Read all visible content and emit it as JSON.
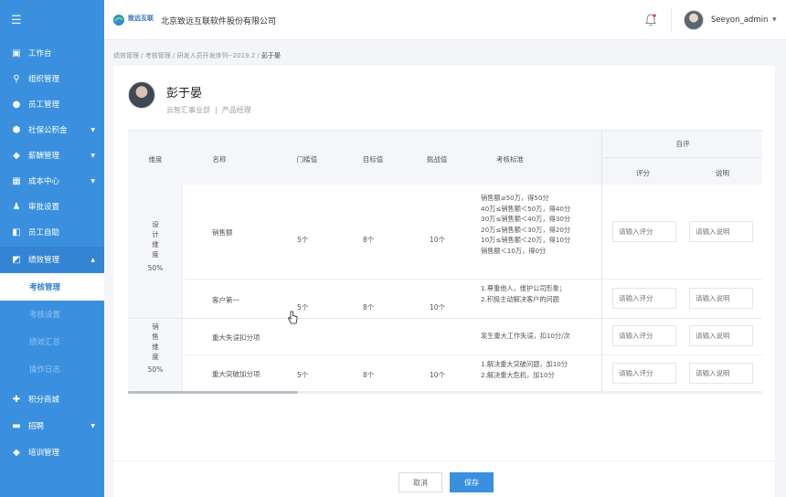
{
  "sidebar": {
    "menu_icon": "menu-icon",
    "items": [
      {
        "label": "工作台",
        "icon": "desktop-icon",
        "caret": false
      },
      {
        "label": "组织管理",
        "icon": "org-icon",
        "caret": false
      },
      {
        "label": "员工管理",
        "icon": "user-icon",
        "caret": false
      },
      {
        "label": "社保公积金",
        "icon": "shield-icon",
        "caret": true
      },
      {
        "label": "薪酬管理",
        "icon": "wallet-icon",
        "caret": true
      },
      {
        "label": "成本中心",
        "icon": "grid-icon",
        "caret": true
      },
      {
        "label": "审批设置",
        "icon": "user-check-icon",
        "caret": false
      },
      {
        "label": "员工自助",
        "icon": "self-service-icon",
        "caret": false
      },
      {
        "label": "绩效管理",
        "icon": "performance-icon",
        "caret": true
      }
    ],
    "perf_subitems": [
      {
        "label": "考核管理"
      },
      {
        "label": "考核设置"
      },
      {
        "label": "绩效汇总"
      },
      {
        "label": "操作日志"
      }
    ],
    "bottom_items": [
      {
        "label": "积分商城",
        "icon": "gift-icon",
        "caret": false
      },
      {
        "label": "招聘",
        "icon": "briefcase-icon",
        "caret": true
      },
      {
        "label": "培训管理",
        "icon": "graduation-icon",
        "caret": false
      }
    ]
  },
  "header": {
    "logo_text": "致远互联",
    "company": "北京致远互联软件股份有限公司",
    "username": "Seeyon_admin"
  },
  "breadcrumb": {
    "items": [
      "绩效管理",
      "考核管理",
      "研发人员开发序列--2019.2"
    ],
    "current": "彭于晏"
  },
  "person": {
    "name": "彭于晏",
    "department": "云智汇事业部",
    "position": "产品经理"
  },
  "table": {
    "headers": {
      "dimension": "维度",
      "name": "名称",
      "threshold": "门槛值",
      "target": "目标值",
      "challenge": "挑战值",
      "standard": "考核标准",
      "self_eval": "自评",
      "score": "评分",
      "note": "说明"
    },
    "groups": [
      {
        "label_chars": [
          "设",
          "计",
          "维",
          "度"
        ],
        "weight": "50%"
      },
      {
        "label_chars": [
          "销",
          "售",
          "维",
          "度"
        ],
        "weight": "50%"
      }
    ],
    "rows": [
      {
        "name": "销售额",
        "threshold": "5个",
        "target": "8个",
        "challenge": "10个",
        "standard": [
          "销售额≥50万，得50分",
          "40万≤销售额＜50万，得40分",
          "30万≤销售额＜40万，得30分",
          "20万≤销售额＜30万，得20分",
          "10万≤销售额＜20万，得10分",
          "销售额＜10万，得0分"
        ]
      },
      {
        "name": "客户第一",
        "threshold": "5个",
        "target": "8个",
        "challenge": "10个",
        "standard": [
          "1.尊重他人，维护公司形象；",
          "2.积极主动解决客户的问题"
        ]
      },
      {
        "name": "重大失误扣分项",
        "threshold": "",
        "target": "",
        "challenge": "",
        "standard": [
          "发生重大工作失误，扣10分/次"
        ]
      },
      {
        "name": "重大突破加分项",
        "threshold": "5个",
        "target": "8个",
        "challenge": "10个",
        "standard": [
          "1.解决重大突破问题，加10分",
          "2.解决重大危机，加10分"
        ]
      }
    ],
    "score_placeholder": "请输入评分",
    "note_placeholder": "请输入说明"
  },
  "footer": {
    "cancel": "取消",
    "save": "保存"
  },
  "colors": {
    "primary": "#3a90df",
    "sidebar_active_bg": "#ffffff"
  }
}
